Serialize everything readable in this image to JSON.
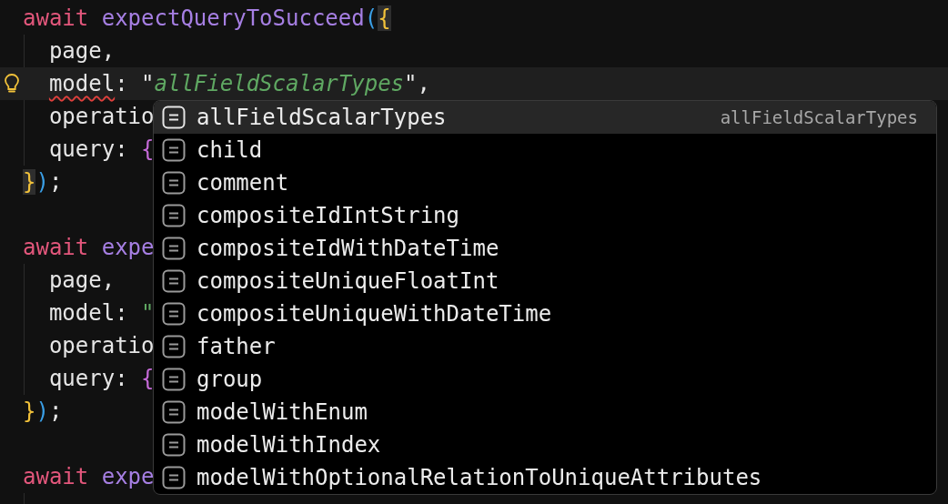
{
  "editor": {
    "lines": [
      {
        "current": false,
        "lightbulb": false,
        "tokens": [
          {
            "text": "await ",
            "kind": "keyword"
          },
          {
            "text": "expectQueryToSucceed",
            "kind": "function"
          },
          {
            "text": "(",
            "kind": "bracket-3"
          },
          {
            "text": "{",
            "kind": "bracket-1-matched"
          }
        ]
      },
      {
        "current": false,
        "lightbulb": false,
        "tokens": [
          {
            "text": "  page,",
            "kind": "plain"
          }
        ]
      },
      {
        "current": true,
        "lightbulb": true,
        "tokens": [
          {
            "text": "  model",
            "kind": "error"
          },
          {
            "text": ": ",
            "kind": "plain"
          },
          {
            "text": "\"",
            "kind": "plain"
          },
          {
            "text": "allFieldScalarTypes",
            "kind": "string"
          },
          {
            "text": "\",",
            "kind": "plain"
          }
        ]
      },
      {
        "current": false,
        "lightbulb": false,
        "tokens": [
          {
            "text": "  operatio",
            "kind": "plain"
          }
        ]
      },
      {
        "current": false,
        "lightbulb": false,
        "tokens": [
          {
            "text": "  query: ",
            "kind": "plain"
          },
          {
            "text": "{",
            "kind": "bracket-2"
          }
        ]
      },
      {
        "current": false,
        "lightbulb": false,
        "tokens": [
          {
            "text": "}",
            "kind": "bracket-1-matched"
          },
          {
            "text": ")",
            "kind": "bracket-3"
          },
          {
            "text": ";",
            "kind": "plain"
          }
        ]
      },
      {
        "current": false,
        "lightbulb": false
      },
      {
        "current": false,
        "lightbulb": false,
        "tokens": [
          {
            "text": "await ",
            "kind": "keyword"
          },
          {
            "text": "expe",
            "kind": "function"
          }
        ]
      },
      {
        "current": false,
        "lightbulb": false,
        "tokens": [
          {
            "text": "  page,",
            "kind": "plain"
          }
        ]
      },
      {
        "current": false,
        "lightbulb": false,
        "tokens": [
          {
            "text": "  model: ",
            "kind": "plain"
          },
          {
            "text": "\"",
            "kind": "string-quote"
          }
        ]
      },
      {
        "current": false,
        "lightbulb": false,
        "tokens": [
          {
            "text": "  operatio",
            "kind": "plain"
          }
        ]
      },
      {
        "current": false,
        "lightbulb": false,
        "tokens": [
          {
            "text": "  query: ",
            "kind": "plain"
          },
          {
            "text": "{",
            "kind": "bracket-2"
          }
        ]
      },
      {
        "current": false,
        "lightbulb": false,
        "tokens": [
          {
            "text": "}",
            "kind": "bracket-1"
          },
          {
            "text": ")",
            "kind": "bracket-3"
          },
          {
            "text": ";",
            "kind": "plain"
          }
        ]
      },
      {
        "current": false,
        "lightbulb": false
      },
      {
        "current": false,
        "lightbulb": false,
        "tokens": [
          {
            "text": "await ",
            "kind": "keyword"
          },
          {
            "text": "expe",
            "kind": "function"
          }
        ]
      }
    ]
  },
  "completion": {
    "items": [
      {
        "label": "allFieldScalarTypes",
        "selected": true,
        "detail": "allFieldScalarTypes"
      },
      {
        "label": "child",
        "selected": false
      },
      {
        "label": "comment",
        "selected": false
      },
      {
        "label": "compositeIdIntString",
        "selected": false
      },
      {
        "label": "compositeIdWithDateTime",
        "selected": false
      },
      {
        "label": "compositeUniqueFloatInt",
        "selected": false
      },
      {
        "label": "compositeUniqueWithDateTime",
        "selected": false
      },
      {
        "label": "father",
        "selected": false
      },
      {
        "label": "group",
        "selected": false
      },
      {
        "label": "modelWithEnum",
        "selected": false
      },
      {
        "label": "modelWithIndex",
        "selected": false
      },
      {
        "label": "modelWithOptionalRelationToUniqueAttributes",
        "selected": false
      }
    ]
  }
}
